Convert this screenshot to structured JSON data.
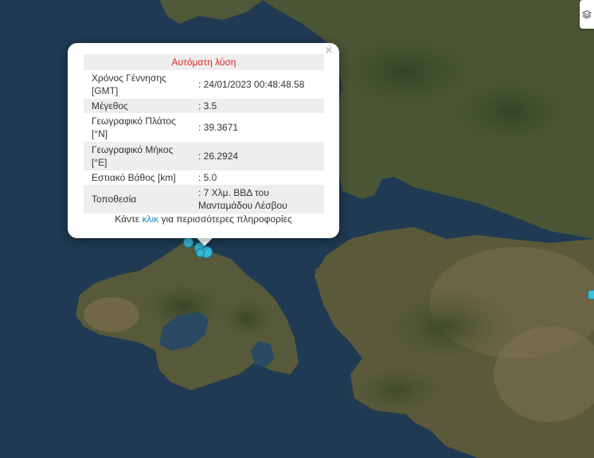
{
  "popup": {
    "header": "Αυτόματη λύση",
    "rows": [
      {
        "label": "Χρόνος Γέννησης [GMT]",
        "value": ": 24/01/2023 00:48:48.58"
      },
      {
        "label": "Μέγεθος",
        "value": ": 3.5"
      },
      {
        "label": "Γεωγραφικό Πλάτος [°N]",
        "value": ": 39.3671"
      },
      {
        "label": "Γεωγραφικό Μήκος [°E]",
        "value": ": 26.2924"
      },
      {
        "label": "Εστιακό Βάθος [km]",
        "value": ": 5.0"
      },
      {
        "label": "Τοποθεσία",
        "value": ": 7 Χλμ. ΒΒΔ του Μανταμάδου Λέσβου"
      }
    ],
    "more_prefix": "Κάντε",
    "more_link": "κλικ",
    "more_suffix": "για περισσότερες πληροφορίες",
    "close_symbol": "×"
  },
  "icons": {
    "layers": "layers-icon",
    "close": "close-icon"
  },
  "colors": {
    "sea": "#1f3a52",
    "marker": "#35b8d6",
    "header_text": "#e32222",
    "link": "#1c8ab7"
  }
}
